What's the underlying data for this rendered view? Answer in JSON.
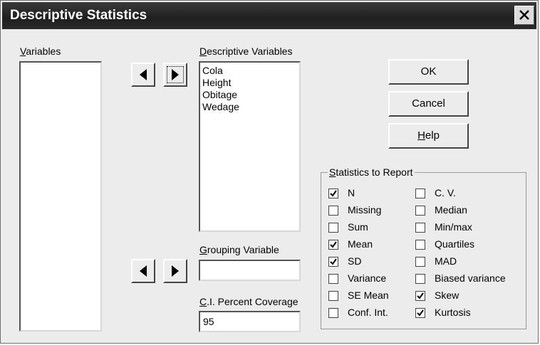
{
  "window": {
    "title": "Descriptive Statistics"
  },
  "variables": {
    "label_u": "V",
    "label_rest": "ariables",
    "items": []
  },
  "descriptive_variables": {
    "label_u": "D",
    "label_rest": "escriptive Variables",
    "items": [
      "Cola",
      "Height",
      "Obitage",
      "Wedage"
    ]
  },
  "grouping_variable": {
    "label_u": "G",
    "label_rest": "rouping Variable",
    "value": ""
  },
  "ci_coverage": {
    "label_u": "C",
    "label_rest": ".I. Percent Coverage",
    "value": "95"
  },
  "buttons": {
    "ok": "OK",
    "cancel": "Cancel",
    "help_u": "H",
    "help_rest": "elp"
  },
  "statistics": {
    "title_u": "S",
    "title_rest": "tatistics to Report",
    "left": [
      {
        "label": "N",
        "checked": true
      },
      {
        "label": "Missing",
        "checked": false
      },
      {
        "label": "Sum",
        "checked": false
      },
      {
        "label": "Mean",
        "checked": true
      },
      {
        "label": "SD",
        "checked": true
      },
      {
        "label": "Variance",
        "checked": false
      },
      {
        "label": "SE Mean",
        "checked": false
      },
      {
        "label": "Conf. Int.",
        "checked": false
      }
    ],
    "right": [
      {
        "label": "C. V.",
        "checked": false
      },
      {
        "label": "Median",
        "checked": false
      },
      {
        "label": "Min/max",
        "checked": false
      },
      {
        "label": "Quartiles",
        "checked": false
      },
      {
        "label": "MAD",
        "checked": false
      },
      {
        "label": "Biased variance",
        "checked": false
      },
      {
        "label": "Skew",
        "checked": true
      },
      {
        "label": "Kurtosis",
        "checked": true
      }
    ]
  }
}
